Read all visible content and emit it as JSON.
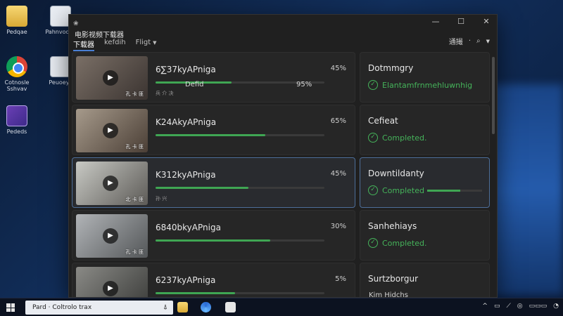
{
  "desktop": {
    "icons": [
      {
        "label": "Pedqae",
        "kind": "folder"
      },
      {
        "label": "Pahnvodes",
        "kind": "doc"
      },
      {
        "label": "Cotnosle\nSshvav",
        "kind": "chrome"
      },
      {
        "label": "Peuoeys",
        "kind": "doc"
      },
      {
        "label": "Pededs",
        "kind": "purple"
      }
    ]
  },
  "window": {
    "title": "电影视频下载器",
    "controls": {
      "minimize": "—",
      "maximize": "☐",
      "close": "✕"
    },
    "tabs": [
      {
        "label": "下载器",
        "active": true
      },
      {
        "label": "kefdih",
        "active": false
      },
      {
        "label": "Fligt",
        "active": false,
        "has_caret": true
      }
    ],
    "toolbar": {
      "sort_label": "通撮",
      "search_glyph": "⌕"
    }
  },
  "downloads": [
    {
      "title": "6∑37kyAPniga",
      "percent": "45%",
      "progress": 0.45,
      "sub": "兵 介 决",
      "extra_label": "Defid",
      "extra_percent": "95%",
      "tag": "孔 卡 匪",
      "thumb": [
        "#7a6f66",
        "#3b3431"
      ]
    },
    {
      "title": "K24AkyAPniga",
      "percent": "65%",
      "progress": 0.65,
      "sub": "",
      "tag": "孔 卡 匪",
      "thumb": [
        "#a69a8b",
        "#4b3f36"
      ]
    },
    {
      "title": "K312kyAPniga",
      "percent": "45%",
      "progress": 0.55,
      "sub": "孙 兴",
      "tag": "北 卡 匪",
      "thumb": [
        "#c8c9c4",
        "#5d5b57"
      ],
      "selected": true
    },
    {
      "title": "6840bkyAPniga",
      "percent": "30%",
      "progress": 0.68,
      "sub": "",
      "tag": "孔 卡 匪",
      "thumb": [
        "#b1b4b7",
        "#545759"
      ]
    },
    {
      "title": "6237kyAPniga",
      "percent": "5%",
      "progress": 0.47,
      "sub": "孔 兵 匪",
      "tag": "孔 卡 匪",
      "thumb": [
        "#8a8a86",
        "#3a3b39"
      ]
    }
  ],
  "status_cards": [
    {
      "title": "Dotmmgry",
      "text": "Elantamfrnmehluwnhig",
      "style": "check"
    },
    {
      "title": "Cefieat",
      "text": "Completed.",
      "style": "check"
    },
    {
      "title": "Downtildanty",
      "text": "Completed",
      "style": "check",
      "progress": 0.6,
      "selected": true
    },
    {
      "title": "Sanhehiays",
      "text": "Completed.",
      "style": "check"
    },
    {
      "title": "Surtzborgur",
      "text": "Kim Hidchs",
      "style": "plain"
    }
  ],
  "taskbar": {
    "search_text": "Pard · Coltrolo trax",
    "search_mic": "⍋",
    "tray_items": [
      "^",
      "▭",
      "⟋",
      "◎",
      "▭▭▭",
      "◔"
    ]
  },
  "colors": {
    "accent_green": "#3fa653",
    "selected_border": "#4d6e99",
    "window_bg": "#202020"
  }
}
